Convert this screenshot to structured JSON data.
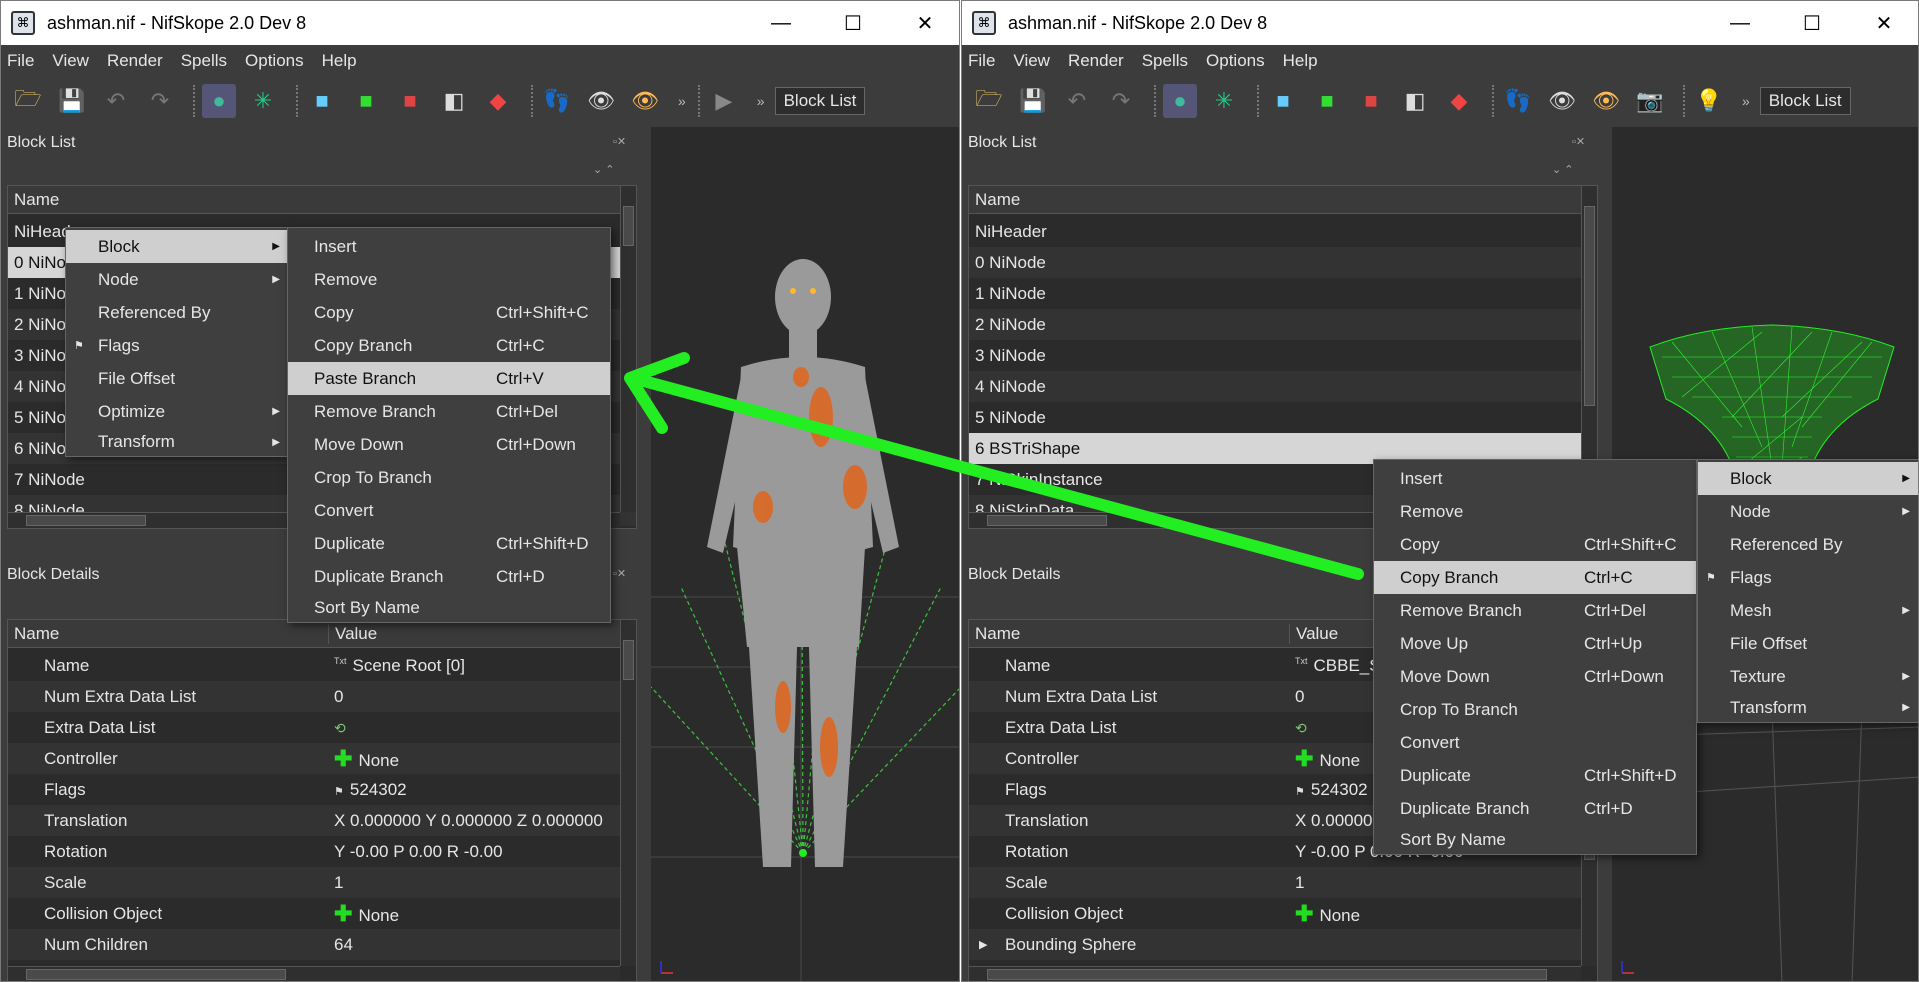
{
  "window_title": "ashman.nif - NifSkope 2.0 Dev 8",
  "menus": [
    "File",
    "View",
    "Render",
    "Spells",
    "Options",
    "Help"
  ],
  "toolbar_combo": "Block List",
  "block_list_title": "Block List",
  "block_details_title": "Block Details",
  "col_name": "Name",
  "col_value": "Value",
  "left": {
    "blocks": [
      "NiHeader",
      "0 NiNode",
      "1 NiNode",
      "2 NiNode",
      "3 NiNode",
      "4 NiNode",
      "5 NiNode",
      "6 NiNode",
      "7 NiNode",
      "8 NiNode"
    ],
    "details": [
      {
        "name": "Name",
        "value": "Scene Root [0]"
      },
      {
        "name": "Num Extra Data List",
        "value": "0"
      },
      {
        "name": "Extra Data List",
        "value": ""
      },
      {
        "name": "Controller",
        "value": "None"
      },
      {
        "name": "Flags",
        "value": "524302"
      },
      {
        "name": "Translation",
        "value": "X 0.000000 Y 0.000000 Z 0.000000"
      },
      {
        "name": "Rotation",
        "value": "Y -0.00 P 0.00 R -0.00"
      },
      {
        "name": "Scale",
        "value": "1"
      },
      {
        "name": "Collision Object",
        "value": "None"
      },
      {
        "name": "Num Children",
        "value": "64"
      }
    ],
    "ctx_main": [
      {
        "label": "Block",
        "submenu": true
      },
      {
        "label": "Node",
        "submenu": true
      },
      {
        "label": "Referenced By",
        "submenu": false
      },
      {
        "label": "Flags",
        "submenu": false
      },
      {
        "label": "File Offset",
        "submenu": false
      },
      {
        "label": "Optimize",
        "submenu": true
      },
      {
        "label": "Transform",
        "submenu": true
      }
    ],
    "ctx_sub": [
      {
        "label": "Insert",
        "shortcut": ""
      },
      {
        "label": "Remove",
        "shortcut": ""
      },
      {
        "label": "Copy",
        "shortcut": "Ctrl+Shift+C"
      },
      {
        "label": "Copy Branch",
        "shortcut": "Ctrl+C"
      },
      {
        "label": "Paste Branch",
        "shortcut": "Ctrl+V"
      },
      {
        "label": "Remove Branch",
        "shortcut": "Ctrl+Del"
      },
      {
        "label": "Move Down",
        "shortcut": "Ctrl+Down"
      },
      {
        "label": "Crop To Branch",
        "shortcut": ""
      },
      {
        "label": "Convert",
        "shortcut": ""
      },
      {
        "label": "Duplicate",
        "shortcut": "Ctrl+Shift+D"
      },
      {
        "label": "Duplicate Branch",
        "shortcut": "Ctrl+D"
      },
      {
        "label": "Sort By Name",
        "shortcut": ""
      }
    ]
  },
  "right": {
    "blocks": [
      "NiHeader",
      "0 NiNode",
      "1 NiNode",
      "2 NiNode",
      "3 NiNode",
      "4 NiNode",
      "5 NiNode",
      "6 BSTriShape",
      "7 NiSkinInstance",
      "8 NiSkinData"
    ],
    "details": [
      {
        "name": "Name",
        "value": "CBBE_S"
      },
      {
        "name": "Num Extra Data List",
        "value": "0"
      },
      {
        "name": "Extra Data List",
        "value": ""
      },
      {
        "name": "Controller",
        "value": "None"
      },
      {
        "name": "Flags",
        "value": "524302"
      },
      {
        "name": "Translation",
        "value": "X 0.00000"
      },
      {
        "name": "Rotation",
        "value": "Y -0.00 P 0.00 R -0.00"
      },
      {
        "name": "Scale",
        "value": "1"
      },
      {
        "name": "Collision Object",
        "value": "None"
      },
      {
        "name": "Bounding Sphere",
        "value": ""
      }
    ],
    "ctx_main": [
      {
        "label": "Insert",
        "shortcut": ""
      },
      {
        "label": "Remove",
        "shortcut": ""
      },
      {
        "label": "Copy",
        "shortcut": "Ctrl+Shift+C"
      },
      {
        "label": "Copy Branch",
        "shortcut": "Ctrl+C"
      },
      {
        "label": "Remove Branch",
        "shortcut": "Ctrl+Del"
      },
      {
        "label": "Move Up",
        "shortcut": "Ctrl+Up"
      },
      {
        "label": "Move Down",
        "shortcut": "Ctrl+Down"
      },
      {
        "label": "Crop To Branch",
        "shortcut": ""
      },
      {
        "label": "Convert",
        "shortcut": ""
      },
      {
        "label": "Duplicate",
        "shortcut": "Ctrl+Shift+D"
      },
      {
        "label": "Duplicate Branch",
        "shortcut": "Ctrl+D"
      },
      {
        "label": "Sort By Name",
        "shortcut": ""
      }
    ],
    "ctx_sub": [
      {
        "label": "Block",
        "submenu": true
      },
      {
        "label": "Node",
        "submenu": true
      },
      {
        "label": "Referenced By",
        "submenu": false
      },
      {
        "label": "Flags",
        "submenu": false
      },
      {
        "label": "Mesh",
        "submenu": true
      },
      {
        "label": "File Offset",
        "submenu": false
      },
      {
        "label": "Texture",
        "submenu": true
      },
      {
        "label": "Transform",
        "submenu": true
      }
    ]
  },
  "colors": {
    "accent_green": "#22ee22",
    "highlight": "#cfcfcf",
    "panel_bg": "#2b2b2b"
  }
}
